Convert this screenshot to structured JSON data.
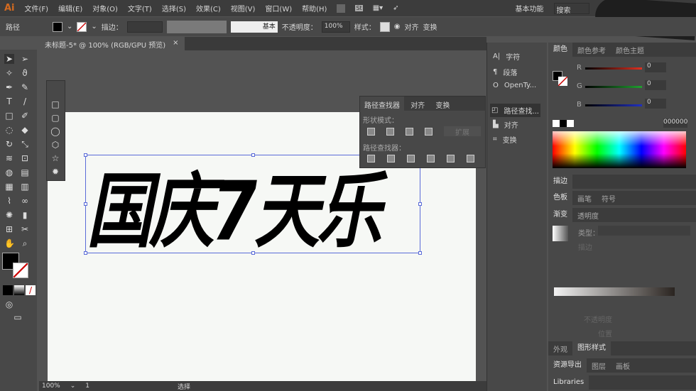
{
  "menu": {
    "logo": "Ai",
    "items": [
      "文件(F)",
      "编辑(E)",
      "对象(O)",
      "文字(T)",
      "选择(S)",
      "效果(C)",
      "视图(V)",
      "窗口(W)",
      "帮助(H)"
    ],
    "workspace": "基本功能",
    "search_placeholder": "搜索"
  },
  "control": {
    "type": "路径",
    "stroke_label": "描边：",
    "stroke_style": "基本",
    "opacity_label": "不透明度：",
    "opacity": "100%",
    "style_label": "样式：",
    "align": "对齐",
    "transform": "变换"
  },
  "document": {
    "tab": "未标题-5* @ 100% (RGB/GPU 预览)",
    "artwork_text": "国庆7天乐"
  },
  "pathfinder": {
    "tabs": [
      "路径查找器",
      "对齐",
      "变换"
    ],
    "shape_modes": "形状模式：",
    "expand": "扩展",
    "pathfinders": "路径查找器："
  },
  "collapsed": [
    "字符",
    "段落",
    "OpenTy...",
    "路径查找...",
    "对齐",
    "变换"
  ],
  "color": {
    "tabs": [
      "颜色",
      "颜色参考",
      "颜色主题"
    ],
    "r": "0",
    "g": "0",
    "b": "0",
    "hex": "000000",
    "colors": {
      "r": "#e03020",
      "g": "#20a030",
      "b": "#2030c0"
    }
  },
  "panels": {
    "stroke": "描边",
    "swatches": [
      "色板",
      "画笔",
      "符号"
    ],
    "gradient": [
      "渐变",
      "透明度"
    ],
    "type_label": "类型：",
    "stroke_sub": "描边",
    "opacity_label": "不透明度",
    "position_label": "位置",
    "appearance": [
      "外观",
      "图形样式"
    ],
    "assets": [
      "资源导出",
      "图层",
      "画板"
    ],
    "libraries": "Libraries"
  },
  "status": {
    "zoom": "100%",
    "page": "1",
    "tool": "选择"
  }
}
